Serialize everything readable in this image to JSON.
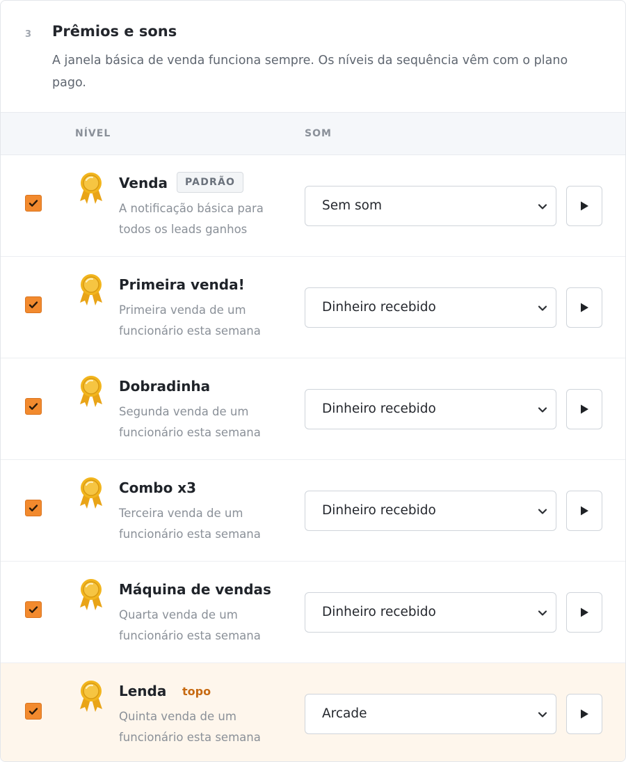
{
  "section": {
    "step": "3",
    "title": "Prêmios e sons",
    "description": "A janela básica de venda funciona sempre. Os níveis da sequência vêm com o plano pago."
  },
  "table": {
    "col_level": "NÍVEL",
    "col_sound": "SOM"
  },
  "colors": {
    "accent": "#f28a2e",
    "highlight_bg": "#fef6ec",
    "top_tag": "#c76a12",
    "medal_gold": "#f2b51d"
  },
  "levels": [
    {
      "checked": true,
      "name": "Venda",
      "badge": "PADRÃO",
      "description": "A notificação básica para todos os leads ganhos",
      "sound": "Sem som",
      "icon": "medal-icon"
    },
    {
      "checked": true,
      "name": "Primeira venda!",
      "description": "Primeira venda de um funcionário esta semana",
      "sound": "Dinheiro recebido",
      "icon": "medal-icon"
    },
    {
      "checked": true,
      "name": "Dobradinha",
      "description": "Segunda venda de um funcionário esta semana",
      "sound": "Dinheiro recebido",
      "icon": "medal-icon"
    },
    {
      "checked": true,
      "name": "Combo x3",
      "description": "Terceira venda de um funcionário esta semana",
      "sound": "Dinheiro recebido",
      "icon": "medal-icon"
    },
    {
      "checked": true,
      "name": "Máquina de vendas",
      "description": "Quarta venda de um funcionário esta semana",
      "sound": "Dinheiro recebido",
      "icon": "medal-icon"
    },
    {
      "checked": true,
      "name": "Lenda",
      "tag": "topo",
      "description": "Quinta venda de um funcionário esta semana",
      "sound": "Arcade",
      "icon": "medal-icon"
    }
  ]
}
